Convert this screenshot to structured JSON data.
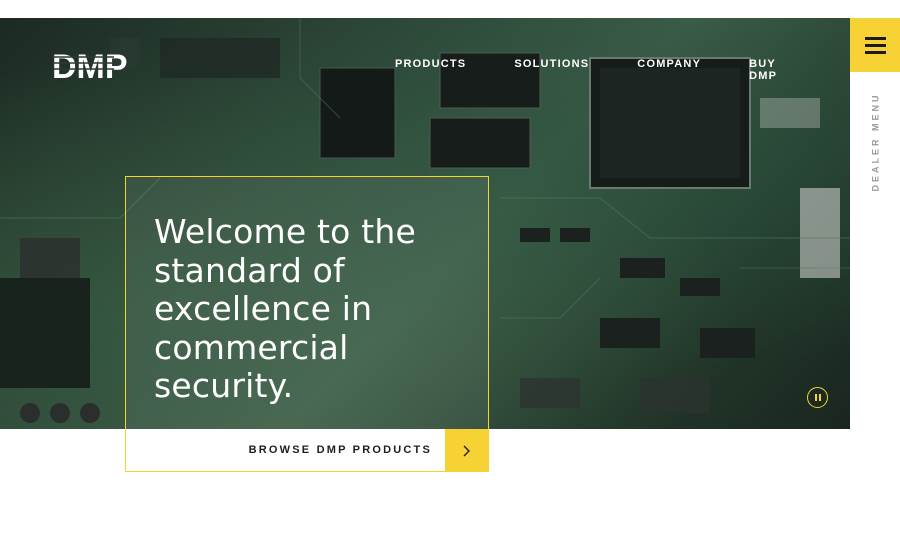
{
  "brand": {
    "logo_text": "DMP"
  },
  "nav": {
    "items": [
      {
        "label": "PRODUCTS"
      },
      {
        "label": "SOLUTIONS"
      },
      {
        "label": "COMPANY"
      },
      {
        "label": "BUY DMP"
      }
    ]
  },
  "side": {
    "menu_icon": "hamburger-icon",
    "dealer_menu_label": "DEALER MENU"
  },
  "hero": {
    "headline": "Welcome to the standard of excellence in commercial security.",
    "cta_label": "BROWSE DMP PRODUCTS",
    "cta_icon": "chevron-right-icon",
    "media_control_icon": "pause-icon"
  },
  "colors": {
    "accent": "#f6d234",
    "text_dark": "#1e1e1e",
    "side_label": "#9a9a9a"
  }
}
